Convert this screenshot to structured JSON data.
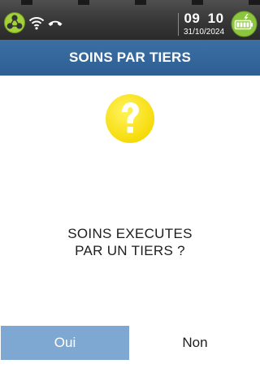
{
  "status_bar": {
    "icons": [
      "network-cluster-icon",
      "wifi-icon",
      "phone-hangup-icon",
      "battery-charging-icon"
    ],
    "time_hour": "09",
    "time_minute": "10",
    "date": "31/10/2024",
    "colors": {
      "background": "#383838",
      "battery_badge": "#8cc63f",
      "cluster_icon": "#9acd32"
    }
  },
  "header": {
    "title": "SOINS PAR TIERS",
    "background": "#2e5f94"
  },
  "dialog": {
    "icon": "question-mark-icon",
    "icon_color": "#ffe600",
    "prompt_line1": "SOINS EXECUTES",
    "prompt_line2": "PAR UN TIERS ?"
  },
  "buttons": {
    "yes_label": "Oui",
    "no_label": "Non",
    "yes_background": "#7ea8d1"
  }
}
